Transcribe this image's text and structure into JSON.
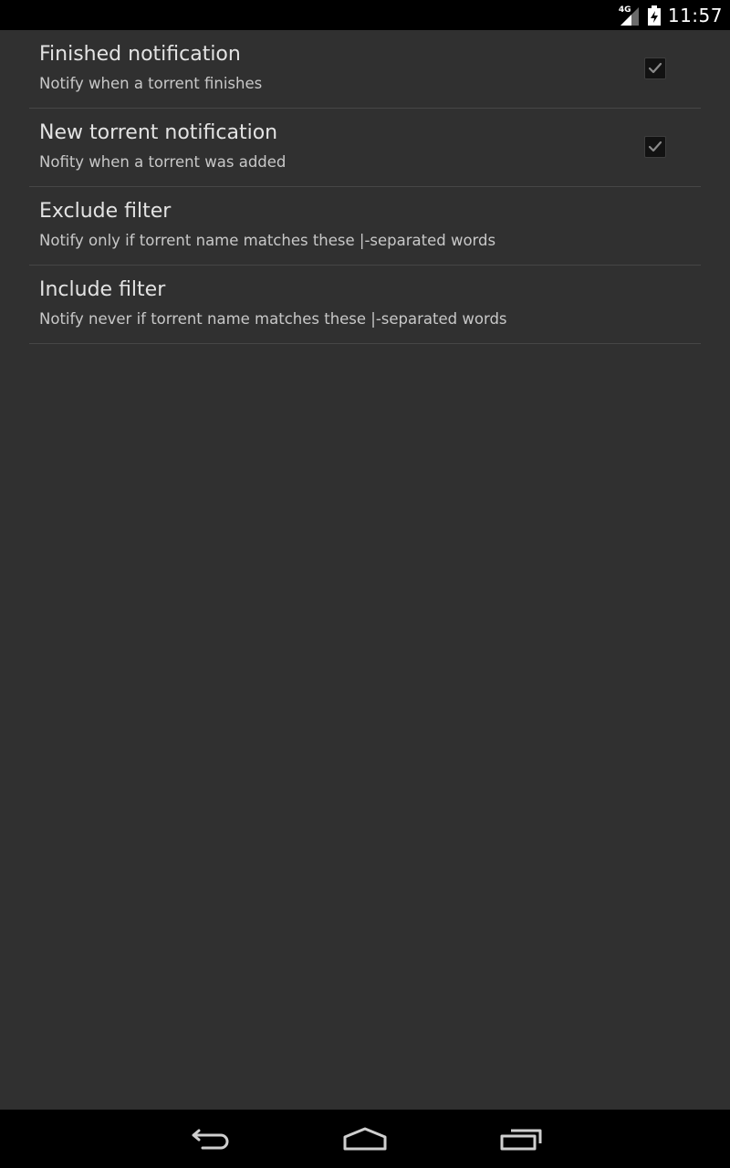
{
  "status_bar": {
    "network_type": "4G",
    "time": "11:57",
    "icons": [
      "signal-icon",
      "battery-charging-icon"
    ]
  },
  "preferences": [
    {
      "title": "Finished notification",
      "summary": "Notify when a torrent finishes",
      "has_checkbox": true,
      "checked": true
    },
    {
      "title": "New torrent notification",
      "summary": "Nofity when a torrent was added",
      "has_checkbox": true,
      "checked": true
    },
    {
      "title": "Exclude filter",
      "summary": "Notify only if torrent name matches these |-separated words",
      "has_checkbox": false
    },
    {
      "title": "Include filter",
      "summary": "Notify never if torrent name matches these |-separated words",
      "has_checkbox": false
    }
  ],
  "navigation": {
    "icons": [
      "back-icon",
      "home-icon",
      "recent-apps-icon"
    ]
  },
  "colors": {
    "background": "#303030",
    "bars": "#000000",
    "title_text": "#e3e3e3",
    "summary_text": "#c8c8c8",
    "divider": "#464646"
  }
}
